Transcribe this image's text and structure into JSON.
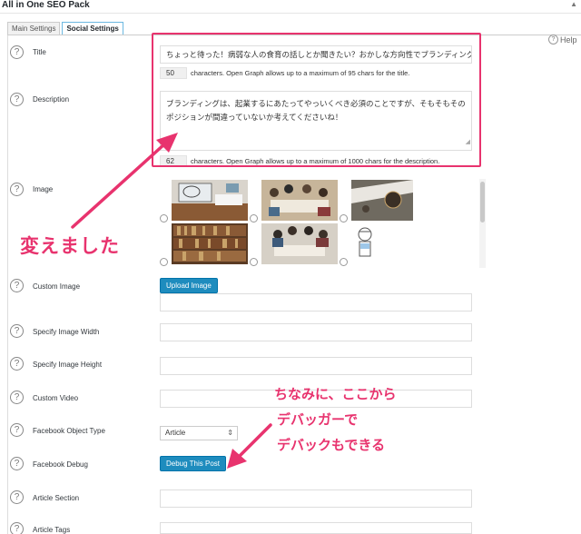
{
  "panel": {
    "title": "All in One SEO Pack"
  },
  "tabs": [
    {
      "label": "Main Settings"
    },
    {
      "label": "Social Settings"
    }
  ],
  "help": {
    "label": "Help"
  },
  "fields": {
    "title": {
      "label": "Title",
      "value": "ちょっと待った！病弱な人の食育の話しとか聞きたい？おかしな方向性でブランディング",
      "count": "50",
      "count_text": "characters. Open Graph allows up to a maximum of 95 chars for the title."
    },
    "description": {
      "label": "Description",
      "line1": "ブランディングは、起業するにあたってやっいくべき必須のことですが、そもそもその",
      "line2": "ポジションが間違っていないか考えてくださいね！",
      "count": "62",
      "count_text": "characters. Open Graph allows up to a maximum of 1000 chars for the description."
    },
    "image": {
      "label": "Image"
    },
    "custom_image": {
      "label": "Custom Image",
      "button": "Upload Image"
    },
    "image_width": {
      "label": "Specify Image Width"
    },
    "image_height": {
      "label": "Specify Image Height"
    },
    "custom_video": {
      "label": "Custom Video"
    },
    "object_type": {
      "label": "Facebook Object Type",
      "selected": "Article"
    },
    "facebook_debug": {
      "label": "Facebook Debug",
      "button": "Debug This Post"
    },
    "article_section": {
      "label": "Article Section"
    },
    "article_tags": {
      "label": "Article Tags"
    }
  },
  "annotations": {
    "changed": "変えました",
    "debug_line1": "ちなみに、ここから",
    "debug_line2": "デバッガーで",
    "debug_line3": "デバックもできる"
  },
  "icons": {
    "help": "question-circle-icon",
    "select": "up-down-arrows-icon",
    "collapse": "triangle-up-icon"
  },
  "colors": {
    "accent": "#e8336e",
    "button": "#1e8cbe",
    "tab_border": "#6cb8e0"
  }
}
